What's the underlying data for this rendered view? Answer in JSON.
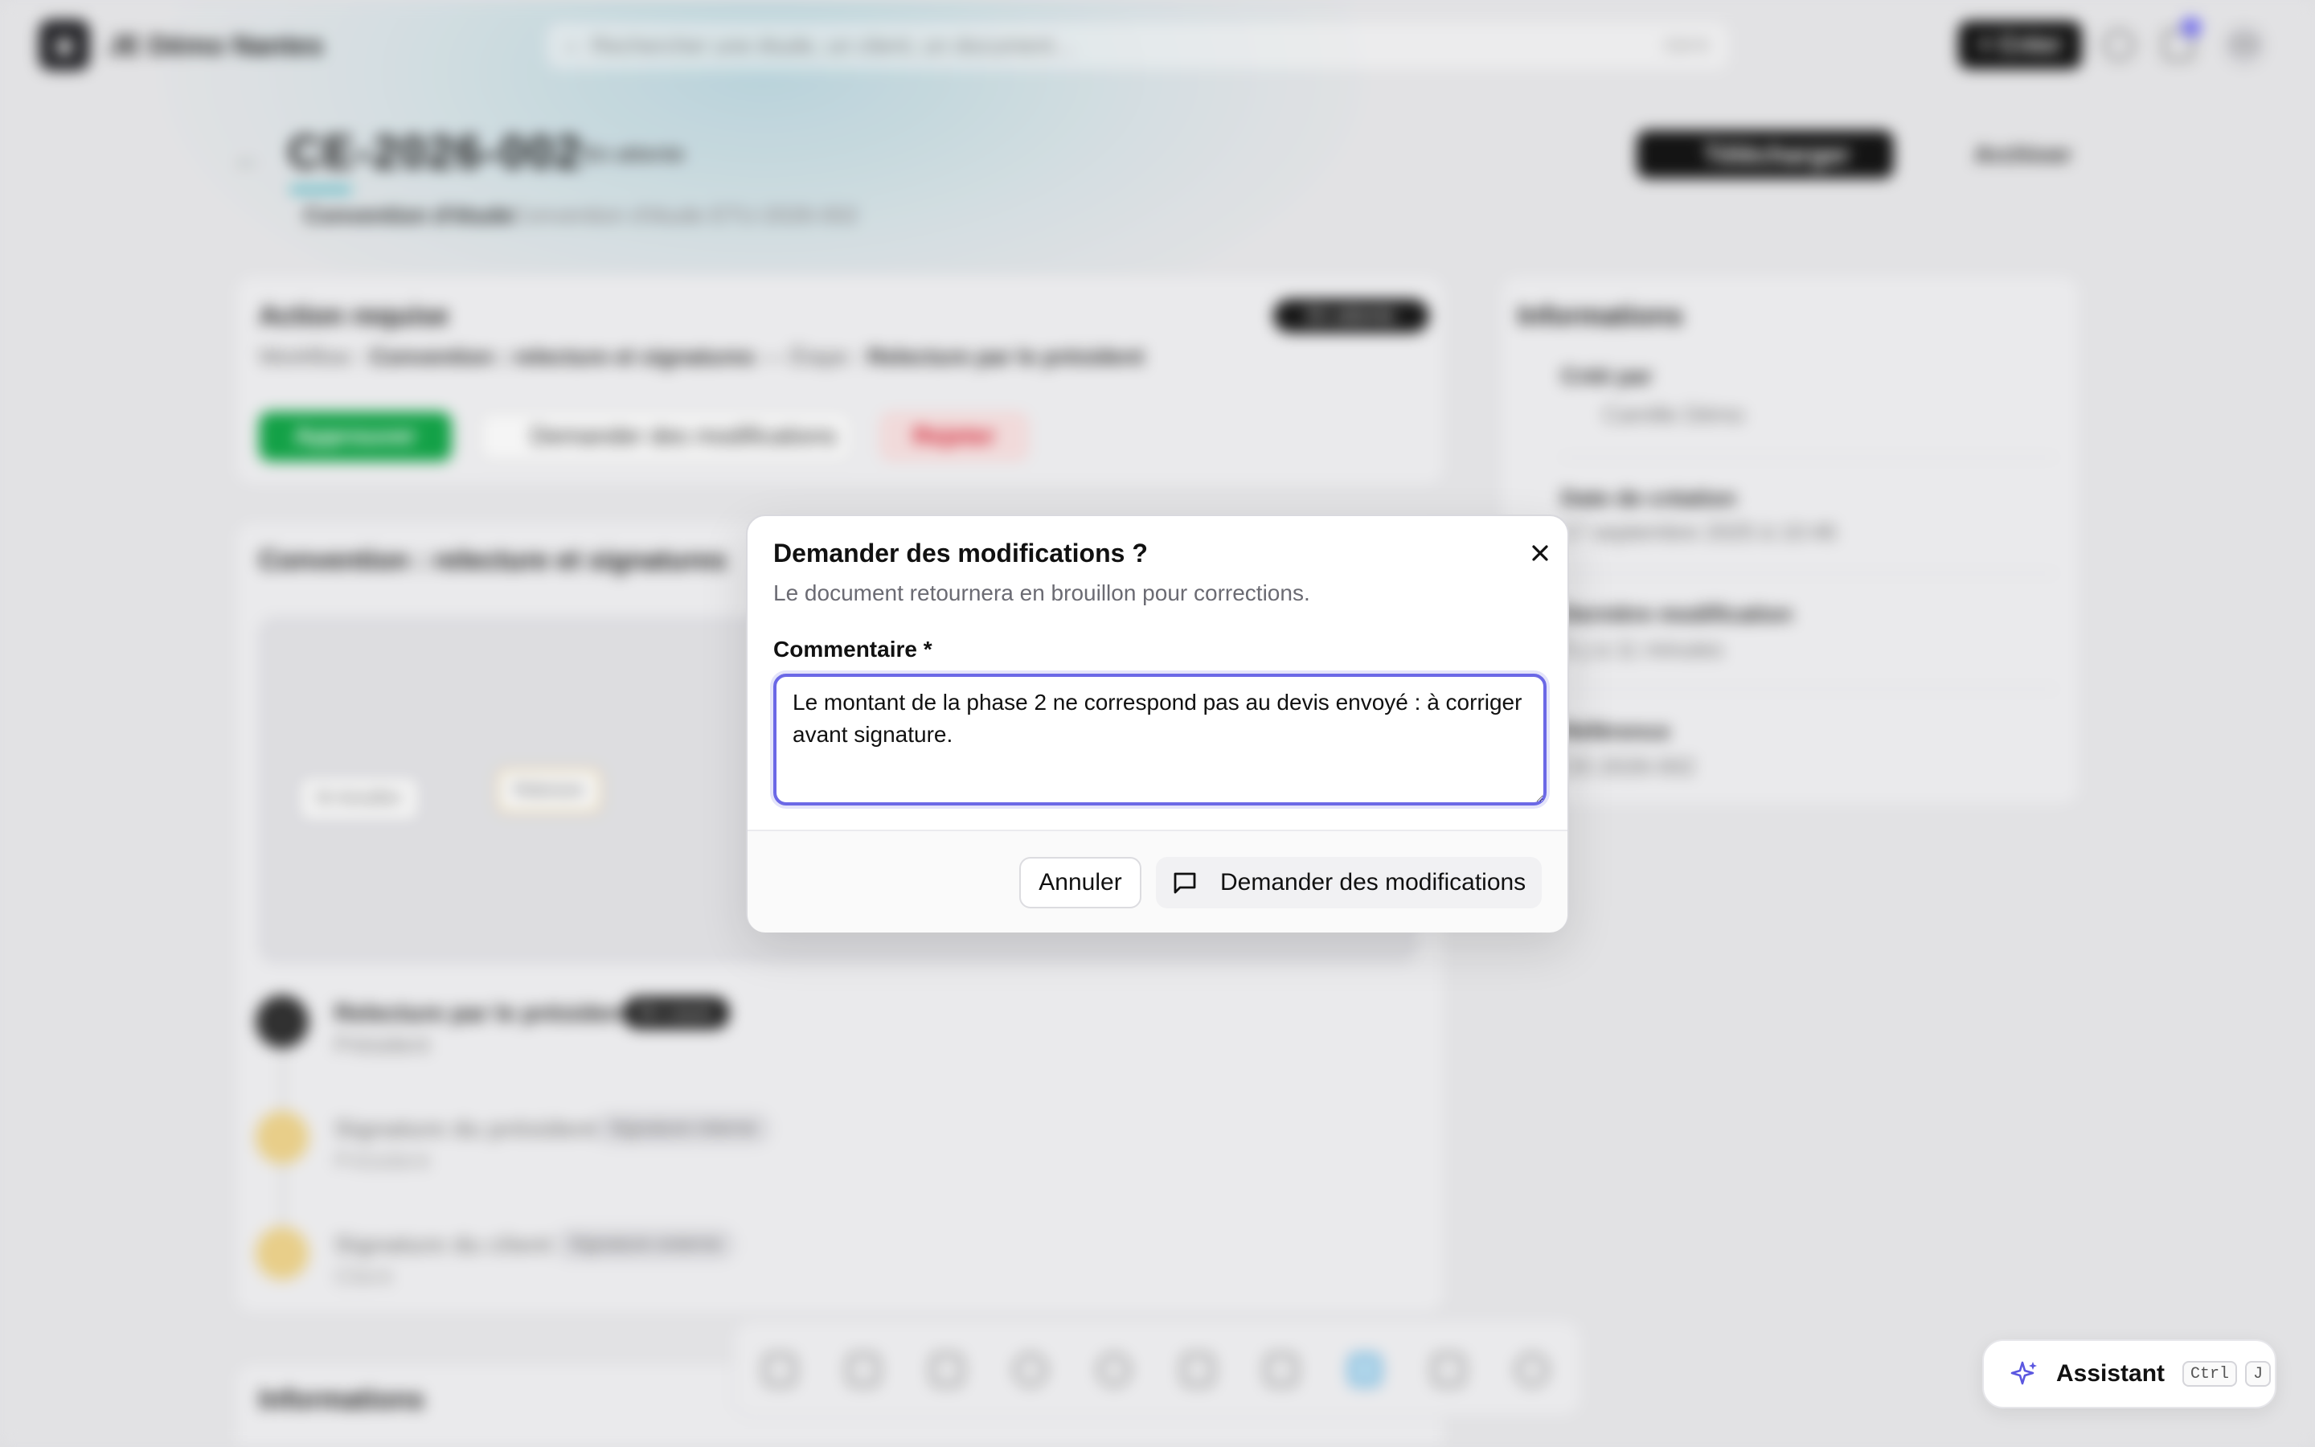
{
  "app": {
    "name": "JE Démo Nantes",
    "search_placeholder": "Rechercher une étude, un client, un document…",
    "search_shortcut": "Ctrl K",
    "create_label": "+ Créer",
    "avatar_initials": "CD"
  },
  "document": {
    "title": "CE-2026-002",
    "status": "En attente",
    "type": "Convention d'étude",
    "subtitle": "Convention d'étude ETU-2026-002",
    "download_label": "Télécharger",
    "archive_label": "Archiver"
  },
  "action_card": {
    "title": "Action requise",
    "badge": "En attente",
    "workflow_prefix": "Workflow :",
    "workflow_name": "Convention : relecture et signatures",
    "step_prefix": "— Étape :",
    "step_name": "Relecture par le président",
    "approve_label": "Approuver",
    "changes_label": "Demander des modifications",
    "reject_label": "Rejeter"
  },
  "workflow_card": {
    "title": "Convention : relecture et signatures",
    "nodes": [
      "En brouillon",
      "Relecture"
    ],
    "steps": [
      {
        "title": "Relecture par le président",
        "subtitle": "Président",
        "chip": "En cours"
      },
      {
        "title": "Signature du président",
        "subtitle": "Président",
        "chip": "Signature interne"
      },
      {
        "title": "Signature du client",
        "subtitle": "Client",
        "chip": "Signature externe"
      }
    ]
  },
  "info_card": {
    "title": "Informations",
    "created_by_label": "Créé par",
    "created_by_value": "Camille Démo",
    "created_at_label": "Date de création",
    "created_at_value": "17 septembre 2025 à 10:46",
    "modified_label": "Dernière modification",
    "modified_value": "Il y a 11 minutes",
    "reference_label": "Référence",
    "reference_value": "CE-2026-002"
  },
  "bottom_section_title": "Informations",
  "modal": {
    "title": "Demander des modifications ?",
    "description": "Le document retournera en brouillon pour corrections.",
    "comment_label": "Commentaire *",
    "comment_value": "Le montant de la phase 2 ne correspond pas au devis envoyé : à corriger avant signature.",
    "cancel_label": "Annuler",
    "submit_label": "Demander des modifications"
  },
  "assistant": {
    "label": "Assistant",
    "kbd_1": "Ctrl",
    "kbd_2": "J"
  },
  "colors": {
    "accent": "#6b68e6",
    "approve": "#14a84a",
    "reject": "#d22233",
    "warning": "#f2c55c"
  }
}
